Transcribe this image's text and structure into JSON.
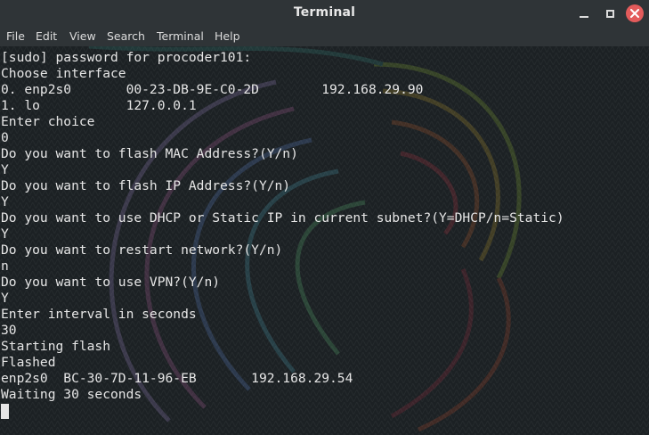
{
  "window": {
    "title": "Terminal",
    "close_icon": "close-icon",
    "maximize_icon": "maximize-icon",
    "minimize_icon": "minimize-icon",
    "close_color": "#e35b5b"
  },
  "menu": {
    "items": [
      "File",
      "Edit",
      "View",
      "Search",
      "Terminal",
      "Help"
    ]
  },
  "terminal": {
    "lines": [
      "[sudo] password for procoder101:",
      "Choose interface",
      "0. enp2s0       00-23-DB-9E-C0-2D        192.168.29.90",
      "1. lo           127.0.0.1",
      "Enter choice",
      "0",
      "Do you want to flash MAC Address?(Y/n)",
      "Y",
      "Do you want to flash IP Address?(Y/n)",
      "Y",
      "Do you want to use DHCP or Static IP in current subnet?(Y=DHCP/n=Static)",
      "Y",
      "Do you want to restart network?(Y/n)",
      "n",
      "Do you want to use VPN?(Y/n)",
      "Y",
      "Enter interval in seconds",
      "30",
      "Starting flash",
      "Flashed",
      "enp2s0  BC-30-7D-11-96-EB       192.168.29.54",
      "Waiting 30 seconds"
    ],
    "text_color": "#e6e6e6",
    "background_color": "#1c2124"
  }
}
